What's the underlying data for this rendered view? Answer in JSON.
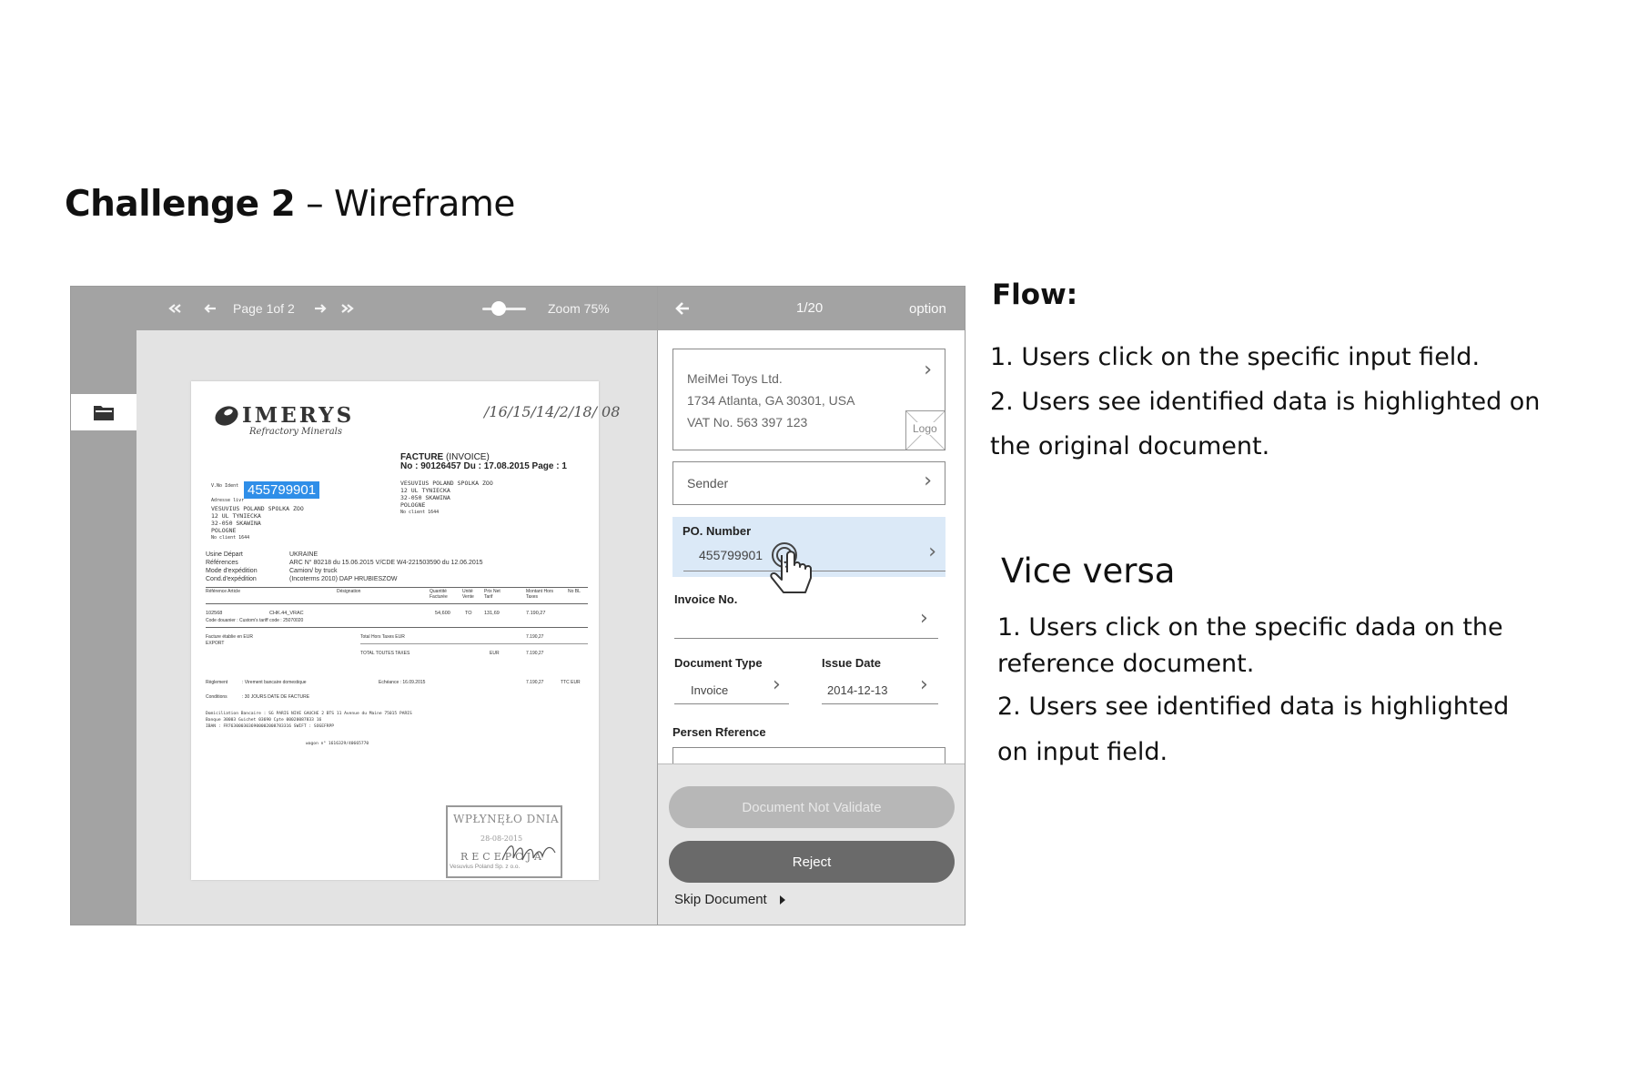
{
  "slide": {
    "title_bold": "Challenge 2",
    "title_rest": " – Wireframe"
  },
  "viewer": {
    "page_label": "Page 1of 2",
    "zoom_label": "Zoom 75%",
    "first_icon": "double-left-arrow",
    "prev_icon": "left-arrow",
    "next_icon": "right-arrow",
    "last_icon": "double-right-arrow",
    "rail_icon": "folder-icon"
  },
  "document": {
    "logo_word": "IMERYS",
    "logo_sub": "Refractory Minerals",
    "signature": "/16/15/14/2/18/ 08",
    "facture_title": "FACTURE",
    "facture_title_sub": "(INVOICE)",
    "facture_line": "No : 90126457 Du : 17.08.2015 Page : 1",
    "vendor_block": [
      "VESUVIUS POLAND SPOLKA ZOO",
      "12 UL TYNIECKA",
      "32-050 SKAWINA",
      "POLOGNE",
      "No client 1644"
    ],
    "vat_label": "V.No Ident",
    "vat_highlight": "455799901",
    "address_label": "Adresse livr",
    "buyer_block": [
      "VESUVIUS POLAND SPOLKA ZOO",
      "12 UL TYNIECKA",
      "32-050 SKAWINA",
      "POLOGNE",
      "No client 1644"
    ],
    "meta_rows": [
      {
        "k": "Usine Départ",
        "v": "UKRAINE"
      },
      {
        "k": "Références",
        "v": "ARC N° 80218 du 15.06.2015 V/CDE W4-221503590 du 12.06.2015"
      },
      {
        "k": "Mode d'expédition",
        "v": "Camion/ by truck"
      },
      {
        "k": "Cond.d'expédition",
        "v": "(Incoterms 2010) DAP HRUBIESZOW"
      }
    ],
    "table_headers": [
      "Référence Article",
      "Désignation",
      "Quantité Facturée",
      "Unité Vente",
      "Prix Net Tarif",
      "Montant Hors Taxes",
      "No BL"
    ],
    "line_item": {
      "ref": "102568",
      "designation": "CHK.44_VRAC",
      "qty": "54,600",
      "unit": "TO",
      "price": "131,69",
      "amount": "7.190,27"
    },
    "customs_code": "Code douanier : Custom's tariff code : 25070020",
    "totals": [
      {
        "label": "Facture établie en EUR",
        "sub": "EXPORT",
        "label2": "Total Hors Taxes EUR",
        "value": "7.190,27"
      },
      {
        "label": "",
        "sub": "",
        "label2": "TOTAL TOUTES TAXES",
        "cur": "EUR",
        "value": "7.190,27"
      }
    ],
    "payment": {
      "label": "Règlement",
      "value": ": Virement bancaire domestique",
      "due": "Echéance : 16.09.2015",
      "amount": "7.190,27",
      "ttc": "TTC EUR"
    },
    "conditions": {
      "label": "Conditions",
      "value": ": 30 JOURS DATE DE FACTURE"
    },
    "bank_lines": [
      "Domiciliation Bancaire : SG PARIS NIVE GAUCHE 2 BTS 11 Avenue du Maine      75015 PARIS",
      "Banque 30003 Guichet 03690 Cpte 00020087833 16",
      "IBAN : FR7630003036900002008783316   SWIFT : SOGEFRPP"
    ],
    "wagon_line": "wagon n° 1616329/40665770",
    "stamp_title": "WPŁYNĘŁO DNIA",
    "stamp_date": "28-08-2015",
    "stamp_recv": "RECEPCJA",
    "stamp_company": "Vesuvius Poland Sp. z o.o."
  },
  "panel": {
    "counter": "1/20",
    "option_label": "option",
    "back_icon": "left-arrow",
    "company_lines": [
      "MeiMei Toys Ltd.",
      "1734 Atlanta, GA 30301, USA",
      "VAT No. 563 397 123"
    ],
    "logo_placeholder": "Logo",
    "sender_label": "Sender",
    "po_label": "PO. Number",
    "po_value": "455799901",
    "invoice_label": "Invoice No.",
    "invoice_value": "",
    "doc_type_label": "Document Type",
    "doc_type_value": "Invoice",
    "issue_date_label": "Issue Date",
    "issue_date_value": "2014-12-13",
    "persen_label": "Persen Rference",
    "btn_not_validate": "Document Not Validate",
    "btn_reject": "Reject",
    "skip_label": "Skip Document",
    "pointer_icon": "hand-pointer-icon",
    "colors": {
      "highlight_field": "#dbe9f7",
      "highlight_doc": "#2f8ee8",
      "reject_bg": "#6a6a6a",
      "disabled_bg": "#b7b7b7"
    }
  },
  "notes": {
    "flow_heading": "Flow:",
    "flow_items": [
      "1. Users click on the specific input field.",
      "2. Users see identified data is highlighted on",
      "the original document."
    ],
    "vice_heading": "Vice versa",
    "vice_items": [
      "1. Users click on the specific dada on the",
      "reference document.",
      "2. Users see identified data is highlighted",
      "on input field."
    ]
  }
}
